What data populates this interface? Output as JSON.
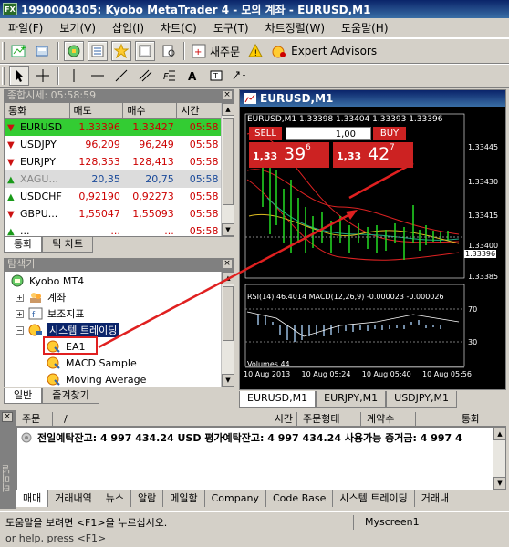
{
  "window": {
    "title": "1990004305: Kyobo MetaTrader 4 - 모의 계좌 - EURUSD,M1",
    "app_icon": "FX"
  },
  "menu": [
    "파일(F)",
    "보기(V)",
    "삽입(I)",
    "차트(C)",
    "도구(T)",
    "차트정렬(W)",
    "도움말(H)"
  ],
  "toolbar": {
    "new_order": "새주문",
    "expert_advisors": "Expert Advisors"
  },
  "market_watch": {
    "title": "종합시세: 05:58:59",
    "columns": [
      "통화",
      "매도",
      "매수",
      "시간"
    ],
    "rows": [
      {
        "symbol": "EURUSD",
        "bid": "1.33396",
        "ask": "1.33427",
        "time": "05:58",
        "dir": "down",
        "style": "sel"
      },
      {
        "symbol": "USDJPY",
        "bid": "96,209",
        "ask": "96,249",
        "time": "05:58",
        "dir": "down",
        "style": ""
      },
      {
        "symbol": "EURJPY",
        "bid": "128,353",
        "ask": "128,413",
        "time": "05:58",
        "dir": "down",
        "style": ""
      },
      {
        "symbol": "XAGU...",
        "bid": "20,35",
        "ask": "20,75",
        "time": "05:58",
        "dir": "up",
        "style": "gray"
      },
      {
        "symbol": "USDCHF",
        "bid": "0,92190",
        "ask": "0,92273",
        "time": "05:58",
        "dir": "up",
        "style": ""
      },
      {
        "symbol": "GBPU...",
        "bid": "1,55047",
        "ask": "1,55093",
        "time": "05:58",
        "dir": "down",
        "style": ""
      },
      {
        "symbol": "...",
        "bid": "...",
        "ask": "...",
        "time": "05:58",
        "dir": "up",
        "style": ""
      }
    ],
    "tabs": [
      "통화",
      "틱 차트"
    ]
  },
  "navigator": {
    "title": "탐색기",
    "root": "Kyobo MT4",
    "items": [
      "계좌",
      "보조지표",
      "시스템 트레이딩",
      "EA1",
      "MACD Sample",
      "Moving Average"
    ],
    "tabs": [
      "일반",
      "즐겨찾기"
    ]
  },
  "chart": {
    "window_title": "EURUSD,M1",
    "info": "EURUSD,M1  1.33398 1.33404 1.33393 1.33396",
    "sell_label": "SELL",
    "buy_label": "BUY",
    "lot": "1,00",
    "sell_price": {
      "prefix": "1,33",
      "big": "39",
      "sup": "6"
    },
    "buy_price": {
      "prefix": "1,33",
      "big": "42",
      "sup": "7"
    },
    "price_labels": [
      "1.33445",
      "1.33430",
      "1.33415",
      "1.33400",
      "1.33396",
      "1.33385"
    ],
    "indicator_text": "RSI(14) 46.4014  MACD(12,26,9) -0.000023 -0.000026",
    "indicator_levels": [
      "70",
      "30"
    ],
    "volumes": "Volumes 44",
    "time_labels": [
      "10 Aug 2013",
      "10 Aug 05:24",
      "10 Aug 05:40",
      "10 Aug 05:56"
    ],
    "tabs": [
      "EURUSD,M1",
      "EURJPY,M1",
      "USDJPY,M1"
    ]
  },
  "terminal": {
    "side_label": "터미널",
    "columns": [
      "주문",
      "/",
      "시간",
      "주문형태",
      "계약수",
      "통화"
    ],
    "balance_row": "전일예탁잔고: 4 997 434.24 USD  평가예탁잔고: 4 997 434.24  사용가능 증거금: 4 997 4",
    "tabs": [
      "매매",
      "거래내역",
      "뉴스",
      "알람",
      "메일함",
      "Company",
      "Code Base",
      "시스템 트레이딩",
      "거래내"
    ]
  },
  "status": {
    "help": "도움말을 보려면 <F1>을 누르십시오.",
    "profile": "Myscreen1",
    "footer": "or help, press <F1>"
  }
}
